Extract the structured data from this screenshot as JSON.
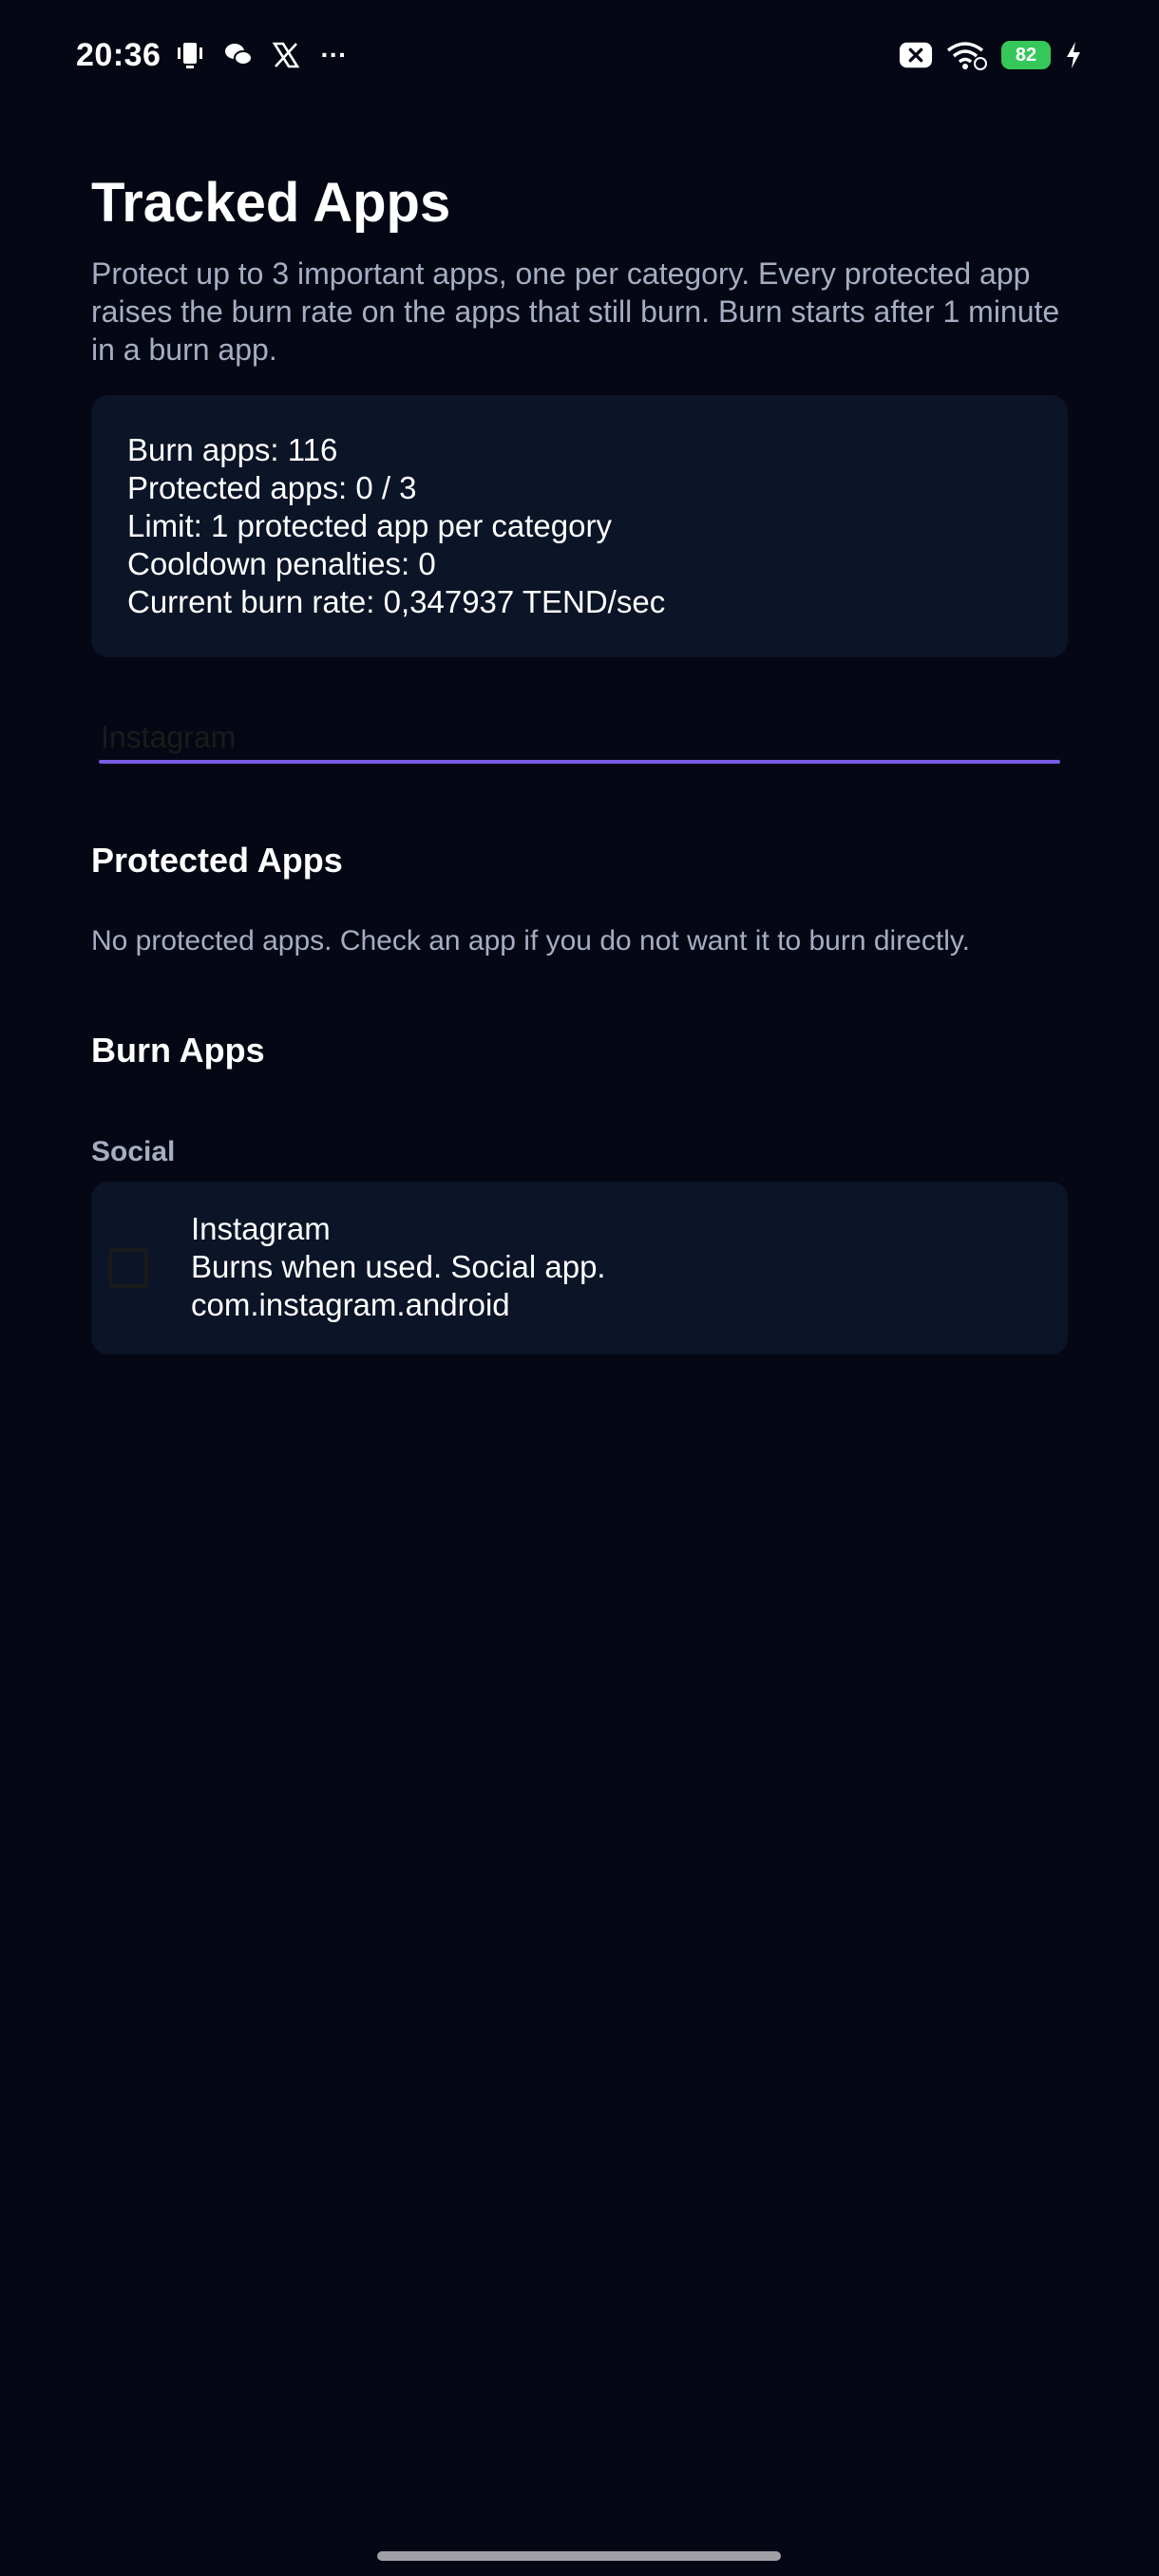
{
  "status_bar": {
    "time": "20:36",
    "left_icons": [
      "phone-vibrate-icon",
      "chat-icon",
      "x-logo-icon",
      "more-dots-icon"
    ],
    "more_glyph": "···",
    "right_icons": [
      "close-badge-icon",
      "wifi-icon",
      "battery-icon",
      "charging-icon"
    ],
    "battery_level": "82",
    "battery_color": "#35c759"
  },
  "page": {
    "title": "Tracked Apps",
    "description": "Protect up to 3 important apps, one per category. Every protected app raises the burn rate on the apps that still burn. Burn starts after 1 minute in a burn app."
  },
  "stats": {
    "burn_apps": "Burn apps: 116",
    "protected_apps": "Protected apps: 0 / 3",
    "limit": "Limit: 1 protected app per category",
    "cooldown": "Cooldown penalties: 0",
    "burn_rate": "Current burn rate: 0,347937 TEND/sec"
  },
  "search": {
    "value": "Instagram",
    "accent_color": "#7b5ce4"
  },
  "protected_section": {
    "title": "Protected Apps",
    "empty_message": "No protected apps. Check an app if you do not want it to burn directly."
  },
  "burn_section": {
    "title": "Burn Apps",
    "categories": [
      {
        "label": "Social",
        "apps": [
          {
            "name": "Instagram",
            "description": "Burns when used. Social app.",
            "package": "com.instagram.android",
            "checked": false
          }
        ]
      }
    ]
  },
  "colors": {
    "background": "#050814",
    "card": "#0c1427",
    "muted_text": "#a6adc3"
  }
}
